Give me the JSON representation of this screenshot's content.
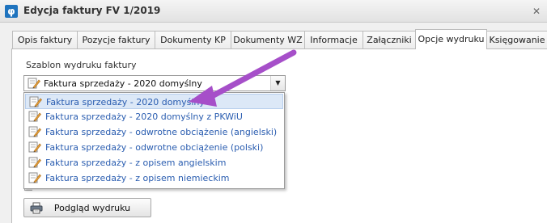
{
  "window": {
    "app_icon": "phi-logo-icon",
    "title": "Edycja faktury FV 1/2019",
    "close_glyph": "✕"
  },
  "tabs": [
    {
      "label": "Opis faktury",
      "active": false
    },
    {
      "label": "Pozycje faktury",
      "active": false
    },
    {
      "label": "Dokumenty KP",
      "active": false
    },
    {
      "label": "Dokumenty WZ",
      "active": false
    },
    {
      "label": "Informacje",
      "active": false
    },
    {
      "label": "Załączniki",
      "active": false
    },
    {
      "label": "Opcje wydruku",
      "active": true
    },
    {
      "label": "Księgowanie",
      "active": false
    }
  ],
  "print_options": {
    "template_label": "Szablon wydruku faktury",
    "selected_template": "Faktura sprzedaży - 2020 domyślny",
    "dropdown_arrow": "▼",
    "options": [
      {
        "label": "Faktura sprzedaży - 2020 domyślny",
        "selected": true
      },
      {
        "label": "Faktura sprzedaży - 2020 domyślny z PKWiU",
        "selected": false
      },
      {
        "label": "Faktura sprzedaży - odwrotne obciążenie (angielski)",
        "selected": false
      },
      {
        "label": "Faktura sprzedaży - odwrotne obciążenie (polski)",
        "selected": false
      },
      {
        "label": "Faktura sprzedaży - z opisem angielskim",
        "selected": false
      },
      {
        "label": "Faktura sprzedaży - z opisem niemieckim",
        "selected": false
      }
    ],
    "preview_button": "Podgląd wydruku"
  },
  "colors": {
    "accent_arrow": "#a64fc9",
    "option_text": "#2a5db0",
    "selection_bg": "#dce8f7"
  },
  "icons": {
    "template_icon": "document-pencil-icon",
    "preview_icon": "printer-icon"
  }
}
